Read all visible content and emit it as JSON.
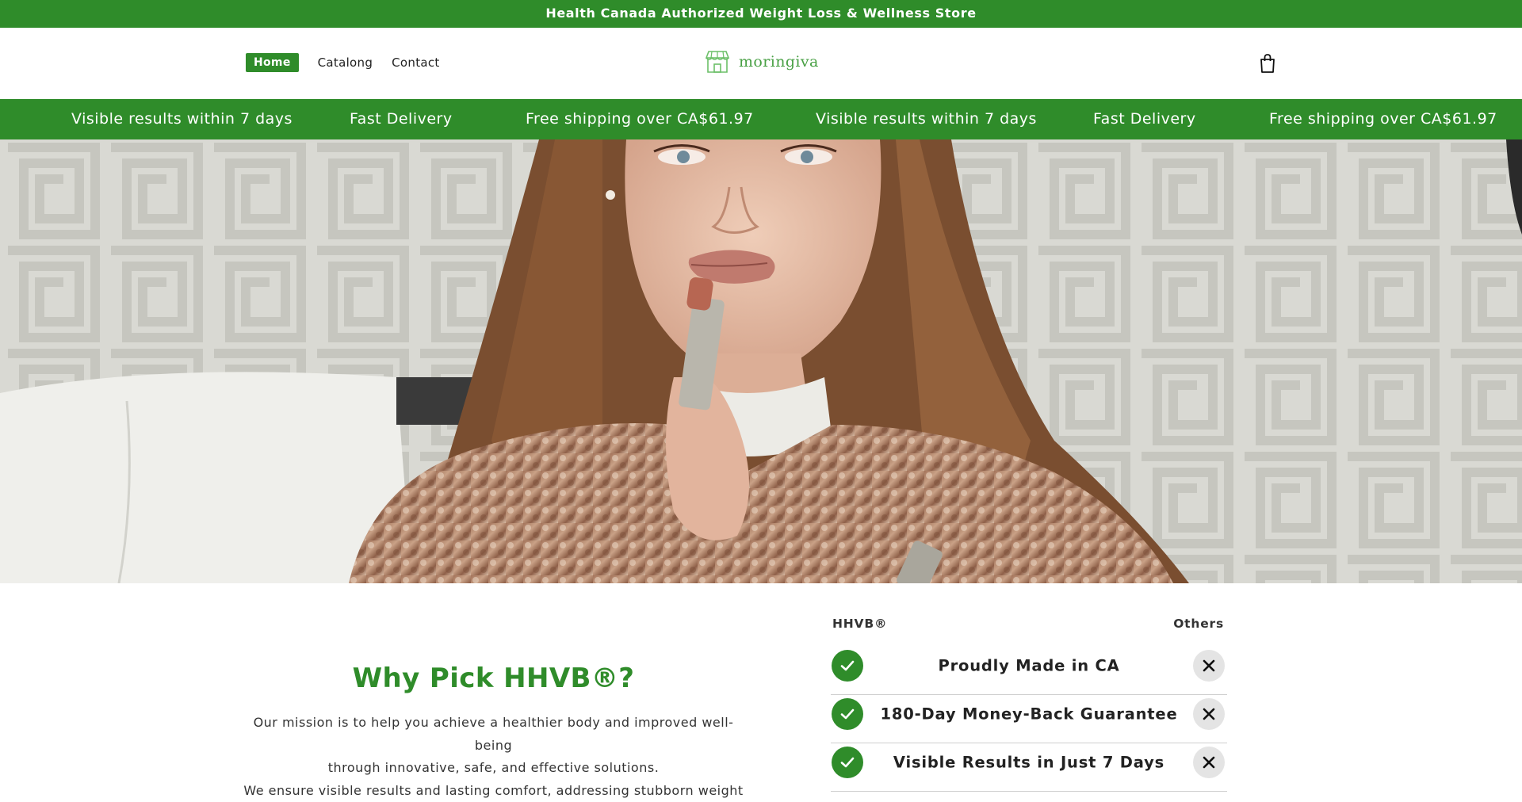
{
  "announcement": "Health Canada Authorized Weight Loss & Wellness Store",
  "nav": {
    "home": "Home",
    "catalog": "Catalong",
    "contact": "Contact"
  },
  "brand": {
    "name": "moringiva",
    "icon": "storefront-icon",
    "color": "#48a044"
  },
  "cart": {
    "icon": "shopping-bag-icon"
  },
  "benefits": [
    "Visible results within 7 days",
    "Fast Delivery",
    "Free shipping over CA$61.97",
    "Visible results within 7 days",
    "Fast Delivery",
    "Free shipping over CA$61.97"
  ],
  "hero": {
    "image": "woman-applying-lipstick-photo"
  },
  "why": {
    "title": "Why Pick HHVB®?",
    "line1": "Our mission is to help you achieve a healthier body and improved well-being",
    "line2": "through innovative, safe, and effective solutions.",
    "line3": "We ensure visible results and lasting comfort, addressing stubborn weight"
  },
  "comparison": {
    "left_header": "HHVB®",
    "right_header": "Others",
    "rows": [
      "Proudly Made in CA",
      "180-Day Money-Back Guarantee",
      "Visible Results in Just 7 Days"
    ]
  },
  "colors": {
    "brand_green": "#2f8c2a",
    "x_circle": "#e4e4e4"
  }
}
